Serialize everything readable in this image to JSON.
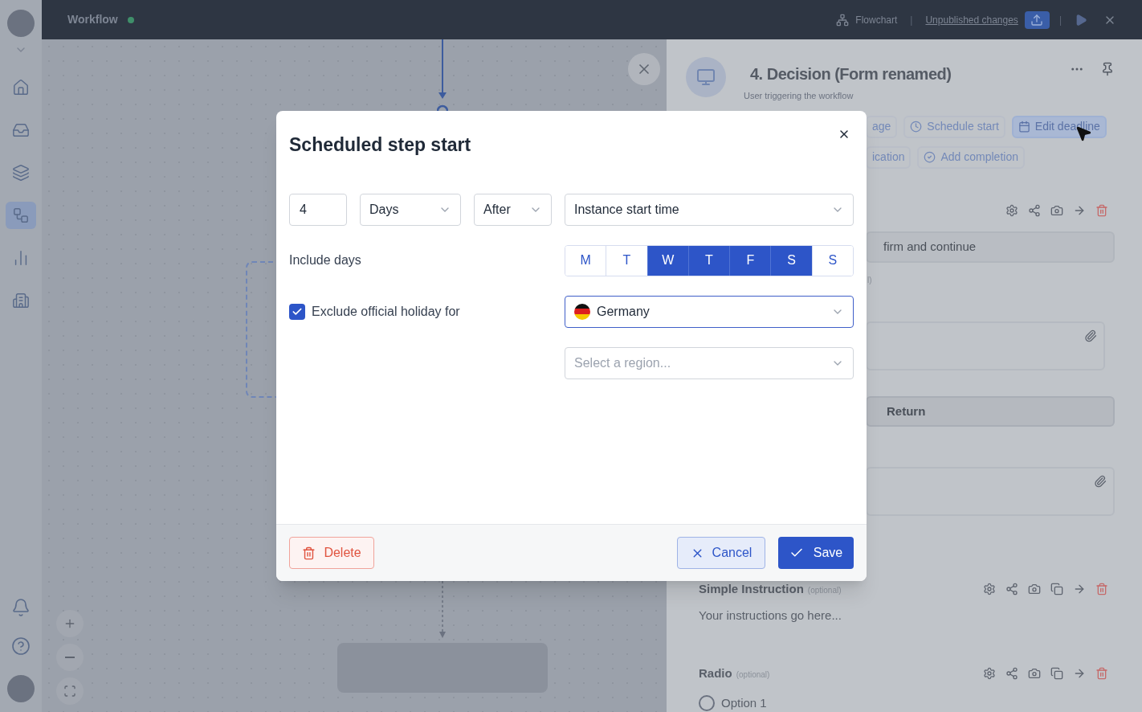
{
  "sidebar": {
    "top": [
      {
        "kind": "home",
        "selected": false
      },
      {
        "kind": "inbox",
        "selected": false
      },
      {
        "kind": "layers",
        "selected": false
      },
      {
        "kind": "workflow",
        "selected": true
      },
      {
        "kind": "chart",
        "selected": false
      },
      {
        "kind": "building",
        "selected": false
      }
    ],
    "bottom": [
      {
        "kind": "bell"
      },
      {
        "kind": "help"
      }
    ]
  },
  "top_bar": {
    "title": "Workflow",
    "flowchart_label": "Flowchart",
    "separator_1": "|",
    "unpublished_link": "Unpublished changes",
    "separator_2": "|"
  },
  "panel": {
    "title": "4. Decision (Form renamed)",
    "subtitle": "User triggering the workflow",
    "action_rows": [
      [
        {
          "label": "age",
          "kind": "plain",
          "selected": false
        },
        {
          "label": "Schedule start",
          "kind": "clock",
          "selected": false
        },
        {
          "label": "Edit deadline",
          "kind": "calendar",
          "selected": true
        }
      ],
      [
        {
          "label": "ication",
          "kind": "plain",
          "selected": false
        },
        {
          "label": "Add completion",
          "kind": "check",
          "selected": false
        }
      ]
    ],
    "blocks": [
      {
        "kind": "toolbar"
      },
      {
        "kind": "input",
        "text": "firm and continue"
      },
      {
        "kind": "note",
        "text": "l)"
      },
      {
        "kind": "attachment"
      },
      {
        "kind": "button",
        "text": "Return"
      },
      {
        "kind": "attachment"
      },
      {
        "kind": "heading",
        "text": "Simple Instruction",
        "hint": "(optional)"
      },
      {
        "kind": "text",
        "text": "Your instructions go here..."
      },
      {
        "kind": "heading",
        "text": "Radio",
        "hint": "(optional)"
      },
      {
        "kind": "radio",
        "text": "Option 1",
        "selected": false
      }
    ]
  },
  "modal": {
    "title": "Scheduled step start",
    "amount": "4",
    "unit": "Days",
    "relation": "After",
    "reference": "Instance start time",
    "include_days_label": "Include days",
    "days": [
      {
        "label": "M",
        "selected": false
      },
      {
        "label": "T",
        "selected": false
      },
      {
        "label": "W",
        "selected": true
      },
      {
        "label": "T",
        "selected": true
      },
      {
        "label": "F",
        "selected": true
      },
      {
        "label": "S",
        "selected": true
      },
      {
        "label": "S",
        "selected": false
      }
    ],
    "holiday": {
      "label": "Exclude official holiday for",
      "checked": true
    },
    "country": "Germany",
    "region_placeholder": "Select a region...",
    "delete_label": "Delete",
    "cancel_label": "Cancel",
    "save_label": "Save"
  }
}
